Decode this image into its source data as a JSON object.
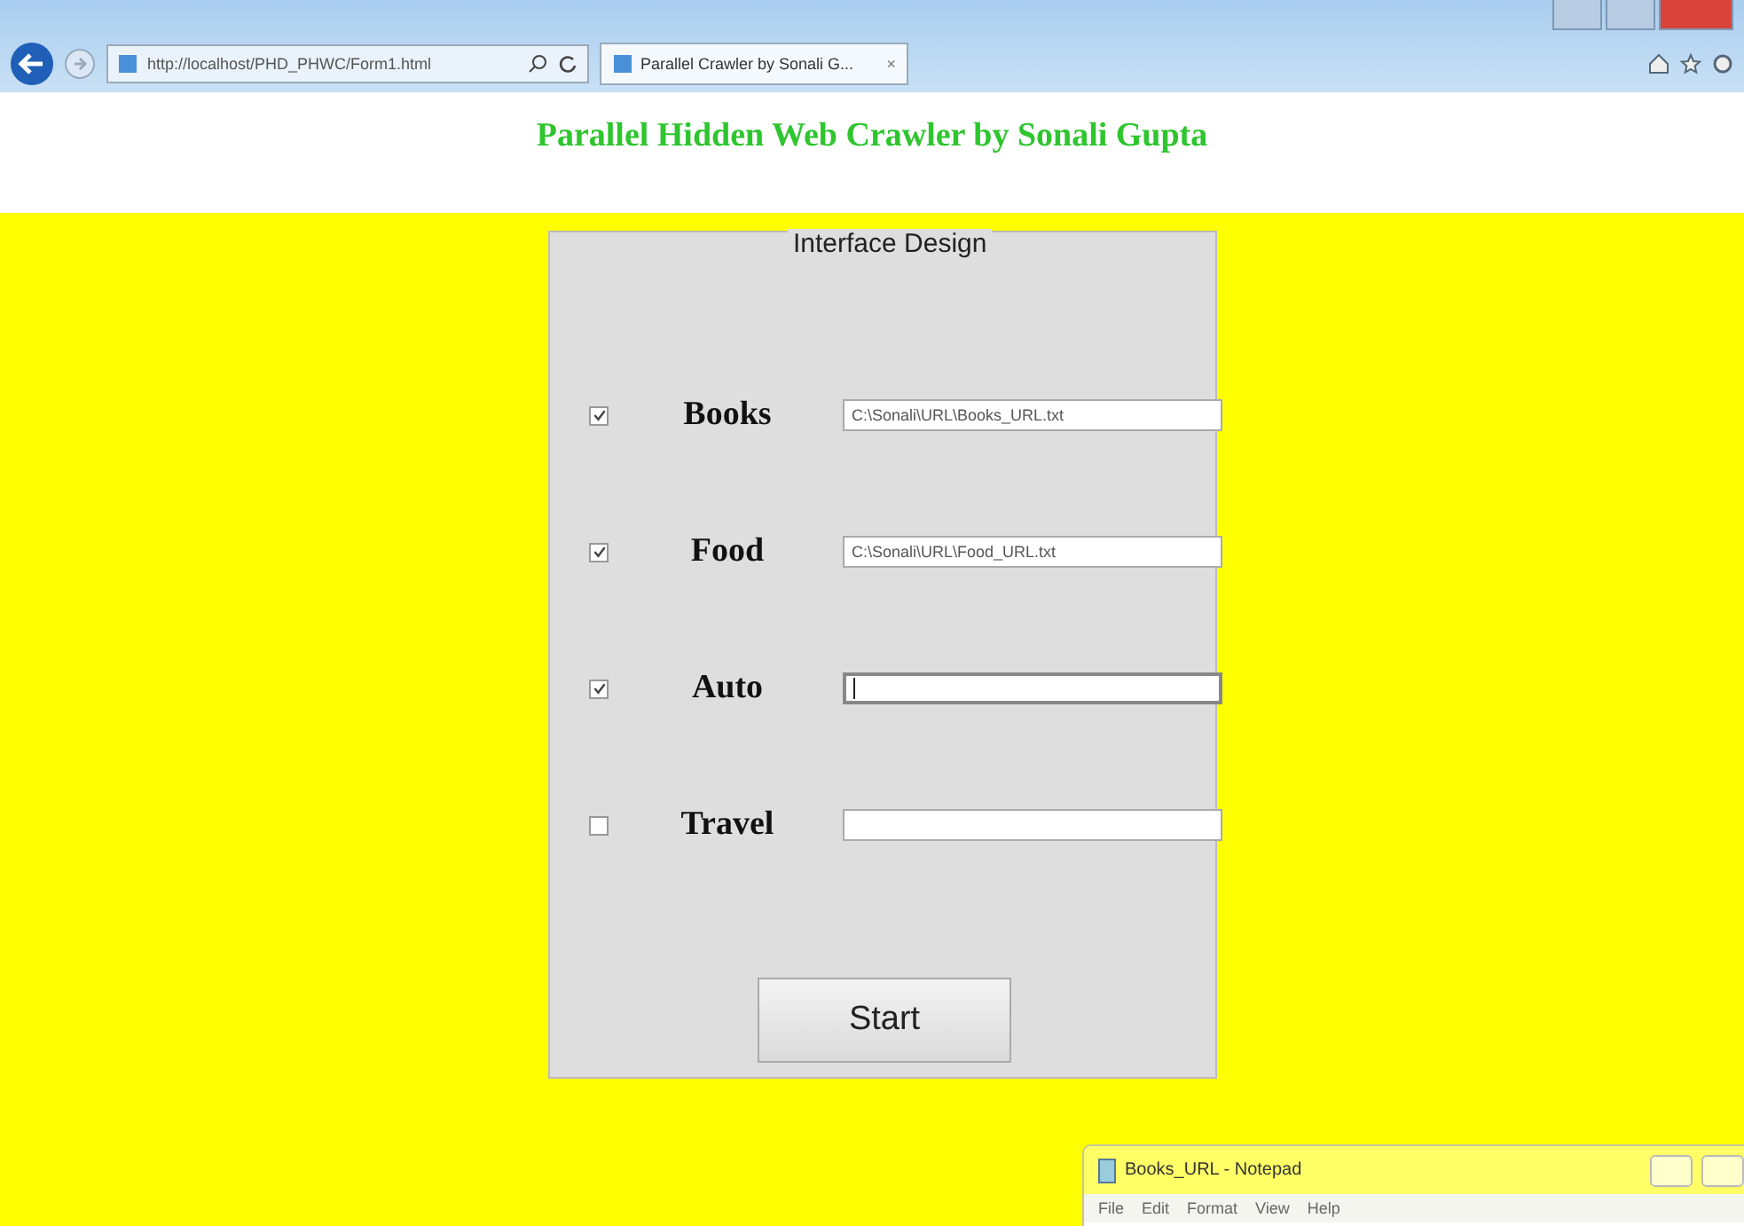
{
  "browser": {
    "address": "http://localhost/PHD_PHWC/Form1.html",
    "tab": {
      "title": "Parallel Crawler by Sonali G...",
      "close": "×"
    }
  },
  "page_title": "Parallel Hidden Web Crawler by Sonali Gupta",
  "form": {
    "legend": "Interface Design",
    "rows": [
      {
        "label": "Books",
        "checked": true,
        "value": "C:\\Sonali\\URL\\Books_URL.txt"
      },
      {
        "label": "Food",
        "checked": true,
        "value": "C:\\Sonali\\URL\\Food_URL.txt"
      },
      {
        "label": "Auto",
        "checked": true,
        "focused": true
      },
      {
        "label": "Travel",
        "checked": false
      }
    ],
    "button": "Start"
  },
  "notepad": {
    "title": "Books_URL - Notepad",
    "menu": [
      "File",
      "Edit",
      "Format",
      "View",
      "Help"
    ]
  }
}
